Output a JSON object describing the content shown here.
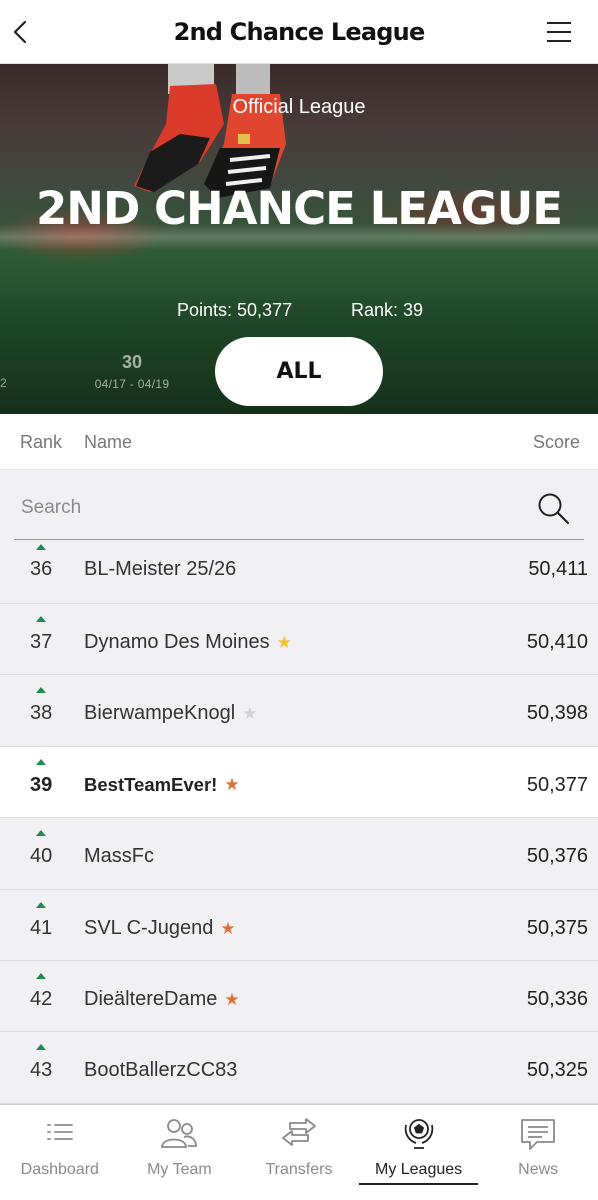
{
  "app": {
    "title": "2nd Chance League"
  },
  "hero": {
    "subtitle": "Official League",
    "title": "2ND CHANCE LEAGUE",
    "points": "Points: 50,377",
    "rank": "Rank: 39",
    "prev_gameweek_fragment": "2",
    "gameweek": {
      "number": "30",
      "dates": "04/17 - 04/19"
    },
    "filter_button": "ALL"
  },
  "columns": {
    "rank": "Rank",
    "name": "Name",
    "score": "Score"
  },
  "search": {
    "placeholder": "Search",
    "value": ""
  },
  "rows": [
    {
      "rank": "36",
      "name": "BL-Meister 25/26",
      "score": "50,411",
      "star": ""
    },
    {
      "rank": "37",
      "name": "Dynamo Des Moines",
      "score": "50,410",
      "star": "gold"
    },
    {
      "rank": "38",
      "name": "BierwampeKnogl",
      "score": "50,398",
      "star": "grey"
    },
    {
      "rank": "39",
      "name": "BestTeamEver!",
      "score": "50,377",
      "star": "orange"
    },
    {
      "rank": "40",
      "name": "MassFc",
      "score": "50,376",
      "star": ""
    },
    {
      "rank": "41",
      "name": "SVL C-Jugend",
      "score": "50,375",
      "star": "orange"
    },
    {
      "rank": "42",
      "name": "DieältereDame",
      "score": "50,336",
      "star": "orange"
    },
    {
      "rank": "43",
      "name": "BootBallerzCC83",
      "score": "50,325",
      "star": ""
    }
  ],
  "colors": {
    "rank_up": "#1e8a4c",
    "star_gold": "#f2c230",
    "star_grey": "#d2d2d2",
    "star_orange": "#e0703a"
  },
  "nav": {
    "items": [
      {
        "label": "Dashboard",
        "icon": "list-icon"
      },
      {
        "label": "My Team",
        "icon": "people-icon"
      },
      {
        "label": "Transfers",
        "icon": "swap-arrows-icon"
      },
      {
        "label": "My Leagues",
        "icon": "trophy-ball-icon"
      },
      {
        "label": "News",
        "icon": "chat-bubble-icon"
      }
    ],
    "active": "My Leagues"
  }
}
